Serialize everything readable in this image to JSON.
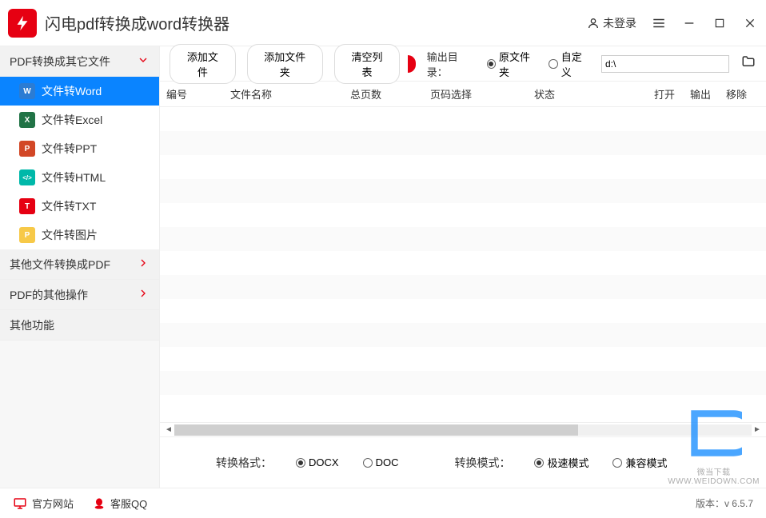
{
  "app": {
    "title": "闪电pdf转换成word转换器"
  },
  "titlebar": {
    "login": "未登录"
  },
  "sidebar": {
    "groups": [
      {
        "label": "PDF转换成其它文件",
        "expanded": true
      },
      {
        "label": "其他文件转换成PDF",
        "expanded": false
      },
      {
        "label": "PDF的其他操作",
        "expanded": false
      },
      {
        "label": "其他功能",
        "expanded": false
      }
    ],
    "items": [
      {
        "label": "文件转Word",
        "icon": "W",
        "color": "#2b7cd3",
        "selected": true
      },
      {
        "label": "文件转Excel",
        "icon": "X",
        "color": "#217346",
        "selected": false
      },
      {
        "label": "文件转PPT",
        "icon": "P",
        "color": "#d24726",
        "selected": false
      },
      {
        "label": "文件转HTML",
        "icon": "</>",
        "color": "#00b8a9",
        "selected": false
      },
      {
        "label": "文件转TXT",
        "icon": "T",
        "color": "#e60012",
        "selected": false
      },
      {
        "label": "文件转图片",
        "icon": "P",
        "color": "#f7c948",
        "selected": false
      }
    ]
  },
  "toolbar": {
    "add_file": "添加文件",
    "add_folder": "添加文件夹",
    "clear_list": "清空列表",
    "output_label": "输出目录：",
    "radio_original": "原文件夹",
    "radio_custom": "自定义",
    "path_value": "d:\\"
  },
  "table": {
    "headers": {
      "index": "编号",
      "filename": "文件名称",
      "pages": "总页数",
      "page_select": "页码选择",
      "status": "状态",
      "open": "打开",
      "output": "输出",
      "remove": "移除"
    }
  },
  "options": {
    "format_label": "转换格式：",
    "format_docx": "DOCX",
    "format_doc": "DOC",
    "mode_label": "转换模式：",
    "mode_fast": "极速模式",
    "mode_compat": "兼容模式"
  },
  "footer": {
    "official": "官方网站",
    "qq": "客服QQ",
    "version_label": "版本：v 6.5.7"
  },
  "watermark": {
    "text": "微当下载",
    "url": "WWW.WEIDOWN.COM"
  }
}
